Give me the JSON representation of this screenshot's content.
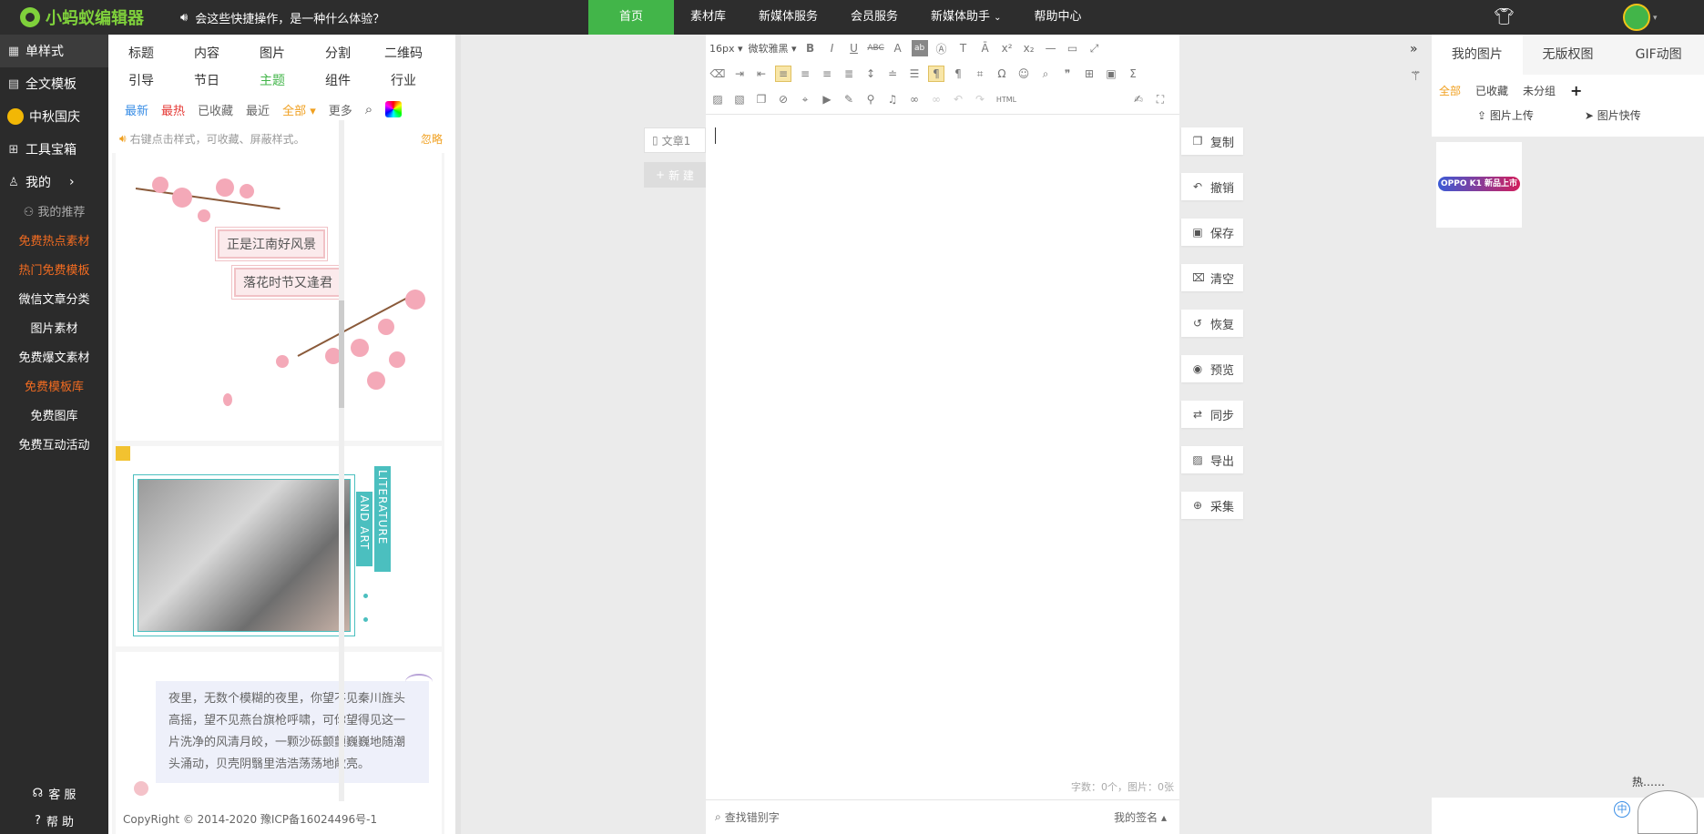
{
  "app": {
    "name": "小蚂蚁编辑器",
    "notice": "会这些快捷操作，是一种什么体验？"
  },
  "nav": [
    {
      "label": "首页",
      "active": true
    },
    {
      "label": "素材库"
    },
    {
      "label": "新媒体服务"
    },
    {
      "label": "会员服务"
    },
    {
      "label": "新媒体助手",
      "dropdown": true
    },
    {
      "label": "帮助中心"
    }
  ],
  "sidebar": {
    "main": [
      {
        "label": "单样式",
        "icon": "grid-icon"
      },
      {
        "label": "全文模板",
        "icon": "template-icon"
      },
      {
        "label": "中秋国庆",
        "icon": "moon-icon"
      },
      {
        "label": "工具宝箱",
        "icon": "toolbox-icon"
      },
      {
        "label": "我的",
        "icon": "user-icon"
      }
    ],
    "sub": [
      {
        "label": "我的推荐",
        "style": "gray"
      },
      {
        "label": "免费热点素材",
        "style": "orange"
      },
      {
        "label": "热门免费模板",
        "style": "orange"
      },
      {
        "label": "微信文章分类",
        "style": "white"
      },
      {
        "label": "图片素材",
        "style": "white"
      },
      {
        "label": "免费爆文素材",
        "style": "white"
      },
      {
        "label": "免费模板库",
        "style": "orange"
      },
      {
        "label": "免费图库",
        "style": "white"
      },
      {
        "label": "免费互动活动",
        "style": "white"
      }
    ],
    "service": "客 服",
    "help": "帮 助"
  },
  "style_tabs": {
    "row1": [
      "标题",
      "内容",
      "图片",
      "分割",
      "二维码"
    ],
    "row2": [
      "引导",
      "节日",
      "主题",
      "组件",
      "行业"
    ]
  },
  "filters": {
    "newest": "最新",
    "hottest": "最热",
    "favorites": "已收藏",
    "recent": "最近",
    "all": "全部",
    "more": "更多"
  },
  "hint": {
    "text": "右键点击样式，可收藏、屏蔽样式。",
    "ignore": "忽略"
  },
  "cards": {
    "c1_line1": "正是江南好风景",
    "c1_line2": "落花时节又逢君",
    "c2_label1": "LITERATURE",
    "c2_label2": "AND ART",
    "c3_poem": "夜里，无数个模糊的夜里，你望不见秦川旌头高摇，望不见燕台旗枪呼啸，可你望得见这一片洗净的风清月皎，一颗沙砾颤颤巍巍地随潮头涌动，贝壳阴翳里浩浩荡荡地敞亮。"
  },
  "copyright": "CopyRight © 2014-2020 豫ICP备16024496号-1",
  "article": {
    "tab": "文章1",
    "new": "新 建"
  },
  "toolbar": {
    "font_size": "16px",
    "font_family": "微软雅黑",
    "html": "HTML"
  },
  "editor": {
    "stats": "字数：0个，图片：0张",
    "find": "查找错别字",
    "signature": "我的签名"
  },
  "actions": [
    {
      "label": "复制",
      "icon": "copy-icon"
    },
    {
      "label": "撤销",
      "icon": "undo-icon"
    },
    {
      "label": "保存",
      "icon": "save-icon"
    },
    {
      "label": "清空",
      "icon": "trash-icon"
    },
    {
      "label": "恢复",
      "icon": "restore-icon"
    },
    {
      "label": "预览",
      "icon": "eye-icon"
    },
    {
      "label": "同步",
      "icon": "sync-icon"
    },
    {
      "label": "导出",
      "icon": "export-icon"
    },
    {
      "label": "采集",
      "icon": "collect-icon"
    }
  ],
  "right_panel": {
    "tabs": [
      "我的图片",
      "无版权图",
      "GIF动图"
    ],
    "filters": {
      "all": "全部",
      "favorites": "已收藏",
      "ungrouped": "未分组"
    },
    "upload": "图片上传",
    "quick": "图片快传",
    "thumb_text": "OPPO K1 新品上市",
    "hot": "热……",
    "ime": "中"
  }
}
